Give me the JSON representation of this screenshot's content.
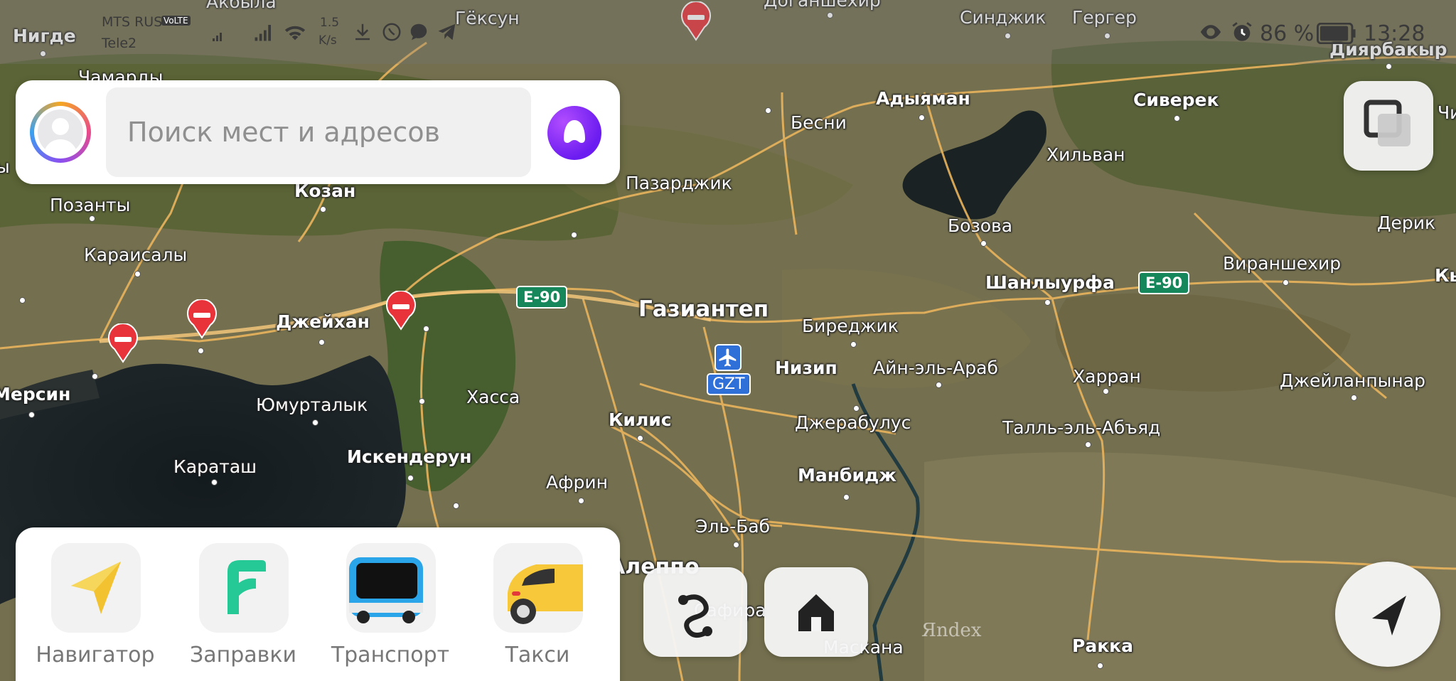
{
  "status_bar": {
    "carrier1": "MTS RUS",
    "carrier1_badge": "VoLTE",
    "carrier2": "Tele2",
    "net_speed_value": "1.5",
    "net_speed_unit": "K/s",
    "battery": "86 %",
    "time": "13:28"
  },
  "search": {
    "placeholder": "Поиск мест и адресов"
  },
  "map": {
    "cities": [
      {
        "name": "Нигде"
      },
      {
        "name": "Чамарды"
      },
      {
        "name": "Акбыла"
      },
      {
        "name": "Гёксун"
      },
      {
        "name": "Доганшехир"
      },
      {
        "name": "Синджик"
      },
      {
        "name": "Гергер"
      },
      {
        "name": "Диярбакыр"
      },
      {
        "name": "Адыяман"
      },
      {
        "name": "Бесни"
      },
      {
        "name": "Сиверек"
      },
      {
        "name": "Хильван"
      },
      {
        "name": "Чина"
      },
      {
        "name": "Позанты"
      },
      {
        "name": "Козан"
      },
      {
        "name": "Пазарджик"
      },
      {
        "name": "Бозова"
      },
      {
        "name": "Дерик"
      },
      {
        "name": "Караисалы"
      },
      {
        "name": "Шанлыурфа"
      },
      {
        "name": "Вираншехир"
      },
      {
        "name": "Кы"
      },
      {
        "name": "Газиантеп"
      },
      {
        "name": "Джейхан"
      },
      {
        "name": "Биреджик"
      },
      {
        "name": "Низип"
      },
      {
        "name": "Айн-эль-Араб"
      },
      {
        "name": "Харран"
      },
      {
        "name": "Джейланпынар"
      },
      {
        "name": "Мерсин"
      },
      {
        "name": "Юмурталык"
      },
      {
        "name": "Хасса"
      },
      {
        "name": "Килис"
      },
      {
        "name": "Джерабулус"
      },
      {
        "name": "Талль-эль-Абъяд"
      },
      {
        "name": "Караташ"
      },
      {
        "name": "Искендерун"
      },
      {
        "name": "Манбидж"
      },
      {
        "name": "Африн"
      },
      {
        "name": "Эль-Баб"
      },
      {
        "name": "Алеппо"
      },
      {
        "name": "Сафира"
      },
      {
        "name": "Маскана"
      },
      {
        "name": "Ракка"
      },
      {
        "name": "ы"
      }
    ],
    "road_badges": [
      "E-90",
      "E-90"
    ],
    "airport_code": "GZT",
    "watermark": "Яndex"
  },
  "services": [
    {
      "label": "Навигатор",
      "icon": "navigator-arrow-icon"
    },
    {
      "label": "Заправки",
      "icon": "fuel-p-icon"
    },
    {
      "label": "Транспорт",
      "icon": "bus-icon"
    },
    {
      "label": "Такси",
      "icon": "taxi-car-icon"
    }
  ],
  "colors": {
    "accent_purple": "#7b2ff7",
    "road_badge_green": "#16875a",
    "block_pin_red": "#e8333a",
    "airport_blue": "#2f6fd8"
  }
}
